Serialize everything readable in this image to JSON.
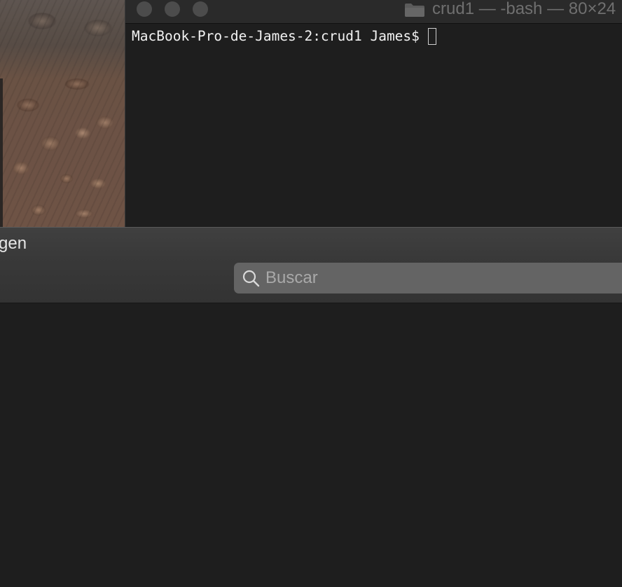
{
  "desktop": {
    "wallpaper": "rock-texture"
  },
  "terminal": {
    "title": "crud1 — -bash — 80×24",
    "prompt": "MacBook-Pro-de-James-2:crud1 James$",
    "traffic_light_color": "#4c4c4c",
    "icons": {
      "title_icon": "folder-icon"
    }
  },
  "lower_window": {
    "title_fragment": "gen",
    "search": {
      "placeholder": "Buscar",
      "value": "",
      "icon": "search-icon"
    }
  },
  "colors": {
    "background": "#1e1e1e",
    "toolbar": "#3a3a3a",
    "search_field": "#646464"
  }
}
